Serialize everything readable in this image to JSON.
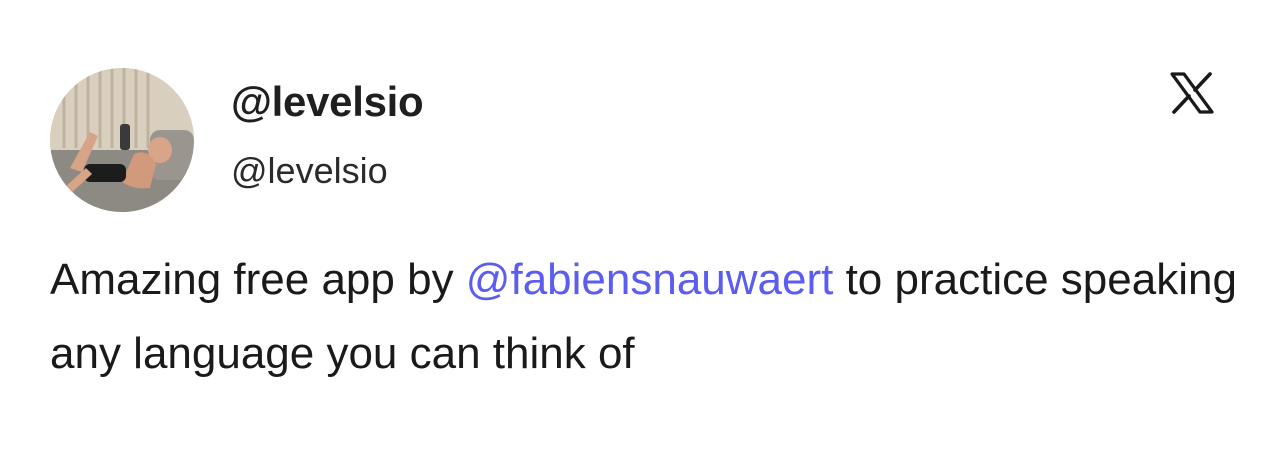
{
  "tweet": {
    "author": {
      "display_name": "@levelsio",
      "handle": "@levelsio",
      "avatar": "profile-photo"
    },
    "platform_icon": "x-logo-icon",
    "text": {
      "before_mention": "Amazing free app by ",
      "mention": "@fabiensnauwaert",
      "after_mention": " to practice speaking any language you can think of"
    }
  },
  "colors": {
    "mention": "#5b5cf0",
    "text": "#1a1a1a",
    "background": "#ffffff"
  }
}
